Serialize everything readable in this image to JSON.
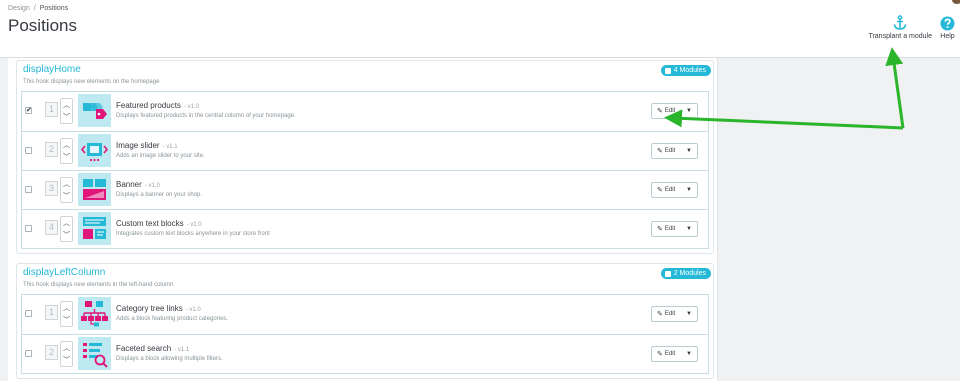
{
  "breadcrumb": {
    "root": "Design",
    "separator": "/",
    "current": "Positions"
  },
  "page_title": "Positions",
  "toolbar": {
    "transplant": {
      "label": "Transplant a module",
      "icon": "anchor-icon"
    },
    "help": {
      "label": "Help",
      "icon": "help-icon"
    }
  },
  "accent_color": "#25b9d7",
  "hooks": [
    {
      "name": "displayHome",
      "description": "This hook displays new elements on the homepage",
      "badge": "4 Modules",
      "modules": [
        {
          "position": "1",
          "checked": true,
          "name": "Featured products",
          "version": "- v1.0",
          "description": "Displays featured products in the central column of your homepage.",
          "edit_label": "Edit",
          "icon": "featured-products-icon"
        },
        {
          "position": "2",
          "checked": false,
          "name": "Image slider",
          "version": "- v1.1",
          "description": "Adds an image slider to your site.",
          "edit_label": "Edit",
          "icon": "image-slider-icon"
        },
        {
          "position": "3",
          "checked": false,
          "name": "Banner",
          "version": "- v1.0",
          "description": "Displays a banner on your shop.",
          "edit_label": "Edit",
          "icon": "banner-icon"
        },
        {
          "position": "4",
          "checked": false,
          "name": "Custom text blocks",
          "version": "- v1.0",
          "description": "Integrates custom text blocks anywhere in your store front",
          "edit_label": "Edit",
          "icon": "custom-text-icon"
        }
      ]
    },
    {
      "name": "displayLeftColumn",
      "description": "This hook displays new elements in the left-hand column",
      "badge": "2 Modules",
      "modules": [
        {
          "position": "1",
          "checked": false,
          "name": "Category tree links",
          "version": "- v1.0",
          "description": "Adds a block featuring product categories.",
          "edit_label": "Edit",
          "icon": "category-tree-icon"
        },
        {
          "position": "2",
          "checked": false,
          "name": "Faceted search",
          "version": "- v1.1",
          "description": "Displays a block allowing multiple filters.",
          "edit_label": "Edit",
          "icon": "faceted-search-icon"
        }
      ]
    }
  ]
}
